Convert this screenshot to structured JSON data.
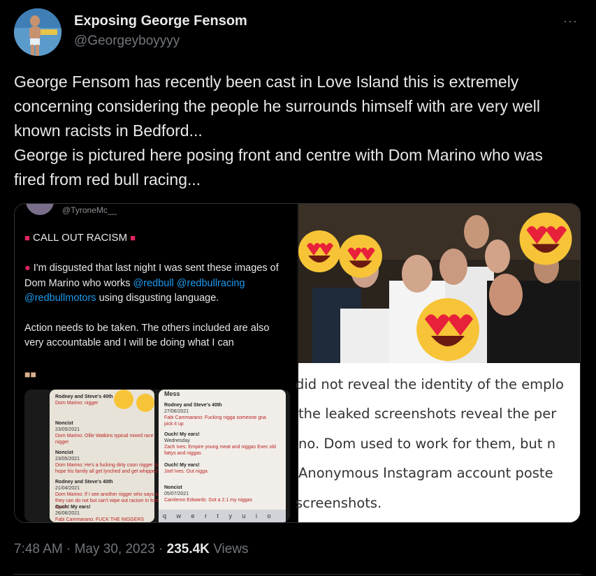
{
  "author": {
    "name": "Exposing George Fensom",
    "handle": "@Georgeyboyyyy"
  },
  "tweet": {
    "text": "George Fensom has recently been cast in Love Island this is extremely concerning considering the people he surrounds himself with are very well known racists in Bedford...\nGeorge is pictured here posing front and centre with Dom Marino who was fired from red bull racing..."
  },
  "media": {
    "left": {
      "handle": "@TyroneMc__",
      "heading": "CALL OUT RACISM",
      "para1_prefix": "I'm disgusted that last night I was sent these images of Dom Marino who works ",
      "link1": "@redbull",
      "link2": "@redbullracing",
      "link3": "@redbullmotors",
      "para1_suffix": " using disgusting language.",
      "para2": "Action needs to be taken. The others included are also very accountable and  I will be doing what I can",
      "chat_left": [
        {
          "title": "Rodney and Steve's 40th",
          "msg": "Dom Marino: nigger"
        },
        {
          "title": "Noncist",
          "date": "23/05/2021",
          "msg": "Dom Marino: Ollie Watkins typical mixed race nigger"
        },
        {
          "title": "Noncist",
          "date": "23/05/2021",
          "msg": "Dom Marino: He's a fucking dirty coon nigger cunt I hope his family all get lynched and get whipped"
        },
        {
          "title": "Rodney and Steve's 40th",
          "date": "21/04/2021",
          "msg": "Dom Marino: If I see another nigger who says so they can do not but can't wipe out racism in football again"
        },
        {
          "title": "Ouch! My ears!",
          "date": "26/06/2021",
          "msg": "Fabi Cammarano: FUCK THE NIGGERS"
        }
      ],
      "chat_right_header": "Mess",
      "chat_right": [
        {
          "title": "Rodney and Steve's 40th",
          "date": "27/06/2021",
          "msg": "Fabi Cammarano: Fucking nigga someone gna pick it up"
        },
        {
          "title": "Ouch! My ears!",
          "date": "Wednesday",
          "msg": "Zach Ives: Empire young meat and niggas  Exec old fattys and niggas"
        },
        {
          "title": "Ouch! My ears!",
          "msg": "Joel Ives: Out nigga"
        },
        {
          "title": "Noncist",
          "date": "05/07/2021",
          "msg": "Camleron Edwards: Got a 2.1 my niggas"
        }
      ],
      "keyboard": "q w e r t y u i o p"
    },
    "right": {
      "article_lines": [
        "did not reveal the identity of the emplo",
        "the leaked screenshots reveal the per",
        "no. Dom used to work for them, but n",
        "Anonymous Instagram account poste",
        "screenshots."
      ]
    }
  },
  "footer": {
    "time": "7:48 AM",
    "date": "May 30, 2023",
    "views_count": "235.4K",
    "views_label": "Views"
  },
  "colors": {
    "background": "#000000",
    "text": "#e7e9ea",
    "muted": "#71767b",
    "link": "#1d9bf0",
    "border": "#2f3336"
  },
  "icons": {
    "more": "more-horizontal-icon",
    "siren": "police-light-icon",
    "angry": "angry-face-icon",
    "fist": "fist-bump-icon",
    "emoji_overlay": "heart-eyes-face-icon"
  }
}
